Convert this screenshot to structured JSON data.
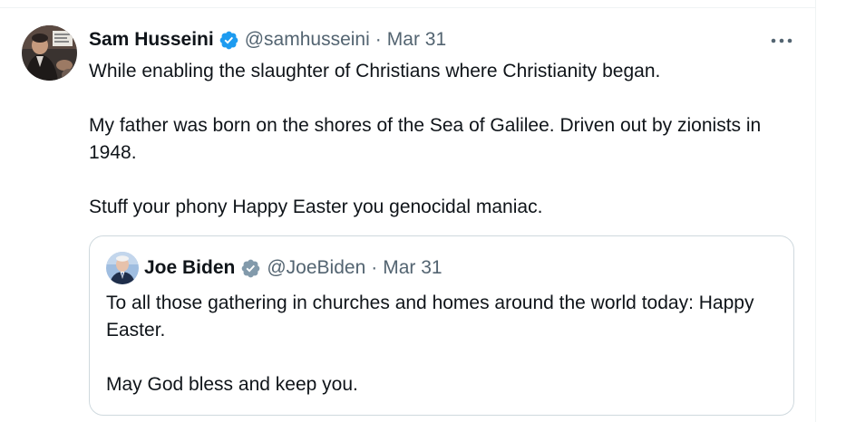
{
  "tweet": {
    "author": {
      "display_name": "Sam Husseini",
      "handle": "@samhusseini",
      "verified_badge": "verified-badge-icon",
      "avatar": "avatar-photo"
    },
    "separator": "·",
    "date": "Mar 31",
    "more_menu": "more-options-icon",
    "paragraphs": [
      "While enabling the slaughter of Christians where Christianity began.",
      "My father was born on the shores of the Sea of Galilee. Driven out by zionists in 1948.",
      "Stuff your phony Happy Easter you genocidal maniac."
    ]
  },
  "quoted_tweet": {
    "author": {
      "display_name": "Joe Biden",
      "handle": "@JoeBiden",
      "verified_badge": "government-verified-badge-icon",
      "avatar": "avatar-photo"
    },
    "separator": "·",
    "date": "Mar 31",
    "paragraphs": [
      "To all those gathering in churches and homes around the world today: Happy Easter.",
      "May God bless and keep you."
    ]
  },
  "colors": {
    "text_primary": "#0f1419",
    "text_secondary": "#536471",
    "verified_blue": "#1d9bf0",
    "verified_gray": "#829aab",
    "border": "#cfd9de",
    "divider": "#eff3f4"
  }
}
